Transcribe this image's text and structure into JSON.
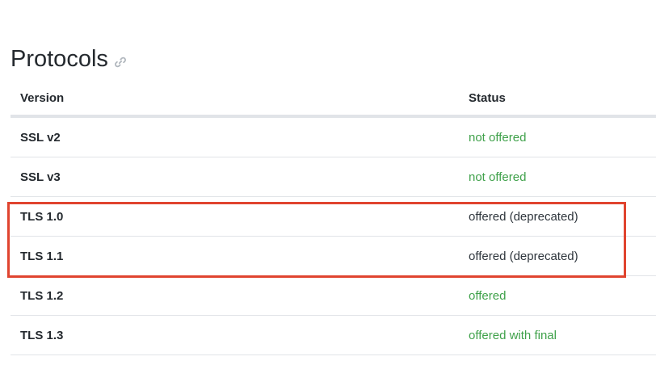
{
  "section": {
    "title": "Protocols",
    "link_icon": "link-icon"
  },
  "table": {
    "headers": {
      "version": "Version",
      "status": "Status"
    },
    "rows": [
      {
        "version": "SSL v2",
        "status": "not offered",
        "tone": "good"
      },
      {
        "version": "SSL v3",
        "status": "not offered",
        "tone": "good"
      },
      {
        "version": "TLS 1.0",
        "status": "offered (deprecated)",
        "tone": "warn"
      },
      {
        "version": "TLS 1.1",
        "status": "offered (deprecated)",
        "tone": "warn"
      },
      {
        "version": "TLS 1.2",
        "status": "offered",
        "tone": "good"
      },
      {
        "version": "TLS 1.3",
        "status": "offered with final",
        "tone": "good"
      }
    ]
  },
  "colors": {
    "good": "#3fa14a",
    "warn": "#2f363d",
    "highlight": "#e0442f"
  }
}
